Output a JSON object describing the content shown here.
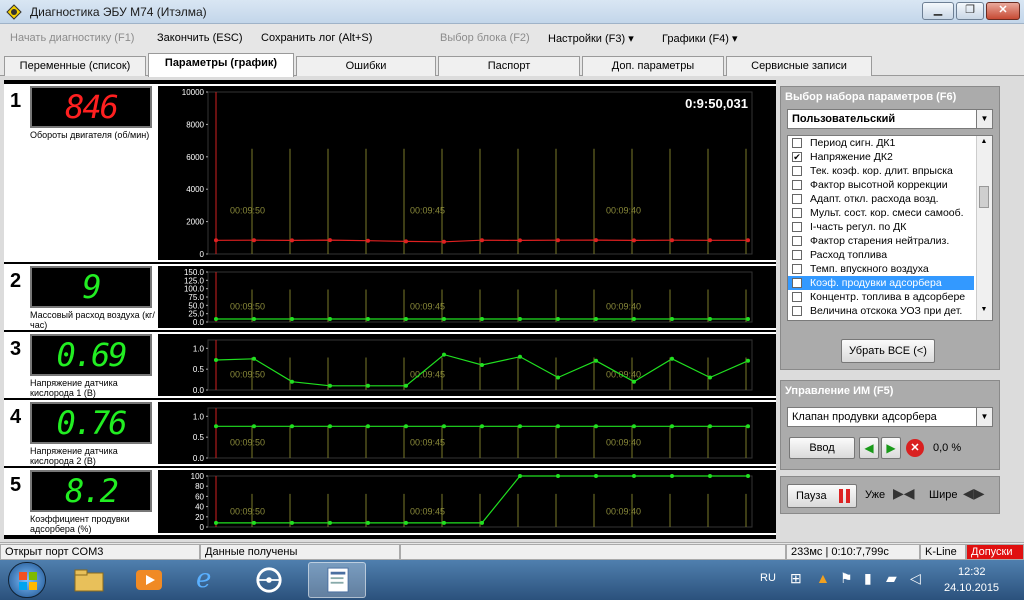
{
  "window": {
    "title": "Диагностика ЭБУ М74 (Итэлма)"
  },
  "menu": {
    "start": "Начать диагностику (F1)",
    "stop": "Закончить (ESC)",
    "save": "Сохранить лог (Alt+S)",
    "block": "Выбор блока (F2)",
    "settings": "Настройки (F3) ▾",
    "graphs": "Графики (F4) ▾"
  },
  "tabs": [
    {
      "label": "Переменные (список)"
    },
    {
      "label": "Параметры (график)"
    },
    {
      "label": "Ошибки"
    },
    {
      "label": "Паспорт"
    },
    {
      "label": "Доп. параметры"
    },
    {
      "label": "Сервисные записи"
    }
  ],
  "rows": [
    {
      "num": "1",
      "value": "846",
      "color": "#ff2020",
      "label": "Обороты двигателя (об/мин)",
      "timer": "0:9:50,031",
      "yticks": [
        "10000",
        "8000",
        "6000",
        "4000",
        "2000",
        "0"
      ]
    },
    {
      "num": "2",
      "value": "9",
      "color": "#22ee22",
      "label": "Массовый расход воздуха (кг/час)",
      "yticks": [
        "150.0",
        "125.0",
        "100.0",
        "75.0",
        "50.0",
        "25.0",
        "0.0"
      ]
    },
    {
      "num": "3",
      "value": "0.69",
      "color": "#22ee22",
      "label": "Напряжение датчика кислорода 1 (В)",
      "yticks": [
        "1.0",
        "0.5",
        "0.0"
      ]
    },
    {
      "num": "4",
      "value": "0.76",
      "color": "#22ee22",
      "label": "Напряжение датчика кислорода 2 (В)",
      "yticks": [
        "1.0",
        "0.5",
        "0.0"
      ]
    },
    {
      "num": "5",
      "value": "8.2",
      "color": "#22ee22",
      "label": "Коэффициент продувки адсорбера (%)",
      "yticks": [
        "100",
        "80",
        "60",
        "40",
        "20",
        "0"
      ]
    }
  ],
  "time_labels": [
    "00:09:50",
    "00:09:45",
    "00:09:40"
  ],
  "param_panel": {
    "header": "Выбор набора параметров (F6)",
    "preset": "Пользовательский",
    "items": [
      {
        "label": "Период сигн. ДК1",
        "checked": false
      },
      {
        "label": "Напряжение ДК2",
        "checked": true
      },
      {
        "label": "Тек. коэф. кор. длит. впрыска",
        "checked": false
      },
      {
        "label": "Фактор высотной коррекции",
        "checked": false
      },
      {
        "label": "Адапт. откл. расхода возд.",
        "checked": false
      },
      {
        "label": "Мульт. сост. кор. смеси самооб.",
        "checked": false
      },
      {
        "label": "I-часть регул. по ДК",
        "checked": false
      },
      {
        "label": "Фактор старения нейтрализ.",
        "checked": false
      },
      {
        "label": "Расход топлива",
        "checked": false
      },
      {
        "label": "Темп. впускного воздуха",
        "checked": false
      },
      {
        "label": "Коэф. продувки адсорбера",
        "checked": true,
        "selected": true
      },
      {
        "label": "Концентр. топлива в адсорбере",
        "checked": false
      },
      {
        "label": "Величина отскока УОЗ при дет.",
        "checked": false
      }
    ],
    "clear_button": "Убрать ВСЕ (<)"
  },
  "control_panel": {
    "header": "Управление ИМ (F5)",
    "device": "Клапан продувки адсорбера",
    "enter_button": "Ввод",
    "value": "0,0 %"
  },
  "playback": {
    "pause": "Пауза",
    "narrow": "Уже",
    "wide": "Шире"
  },
  "status": {
    "port": "Открыт порт COM3",
    "data": "Данные получены",
    "timing": "233мс | 0:10:7,799с",
    "line": "K-Line",
    "mode": "Допуски"
  },
  "tray": {
    "lang": "RU",
    "time": "12:32",
    "date": "24.10.2015"
  },
  "chart_data": [
    {
      "type": "line",
      "series": [
        {
          "values": [
            846,
            850,
            840,
            860,
            820,
            780,
            750,
            850,
            840,
            850,
            860,
            840,
            850,
            845,
            846
          ]
        }
      ],
      "ylim": [
        0,
        10000
      ]
    },
    {
      "type": "line",
      "series": [
        {
          "values": [
            9,
            9,
            9,
            9,
            9,
            9,
            9,
            9,
            9,
            9,
            9,
            9,
            9,
            9,
            9
          ]
        }
      ],
      "ylim": [
        0,
        150
      ]
    },
    {
      "type": "line",
      "series": [
        {
          "values": [
            0.72,
            0.75,
            0.2,
            0.1,
            0.1,
            0.1,
            0.85,
            0.6,
            0.8,
            0.3,
            0.7,
            0.2,
            0.75,
            0.3,
            0.7
          ]
        }
      ],
      "ylim": [
        0,
        1.2
      ]
    },
    {
      "type": "line",
      "series": [
        {
          "values": [
            0.76,
            0.76,
            0.76,
            0.76,
            0.76,
            0.76,
            0.76,
            0.76,
            0.76,
            0.76,
            0.76,
            0.76,
            0.76,
            0.76,
            0.76
          ]
        }
      ],
      "ylim": [
        0,
        1.2
      ]
    },
    {
      "type": "line",
      "series": [
        {
          "values": [
            8,
            8,
            8,
            8,
            8,
            8,
            8,
            8,
            100,
            100,
            100,
            100,
            100,
            100,
            100
          ]
        }
      ],
      "ylim": [
        0,
        100
      ]
    }
  ]
}
